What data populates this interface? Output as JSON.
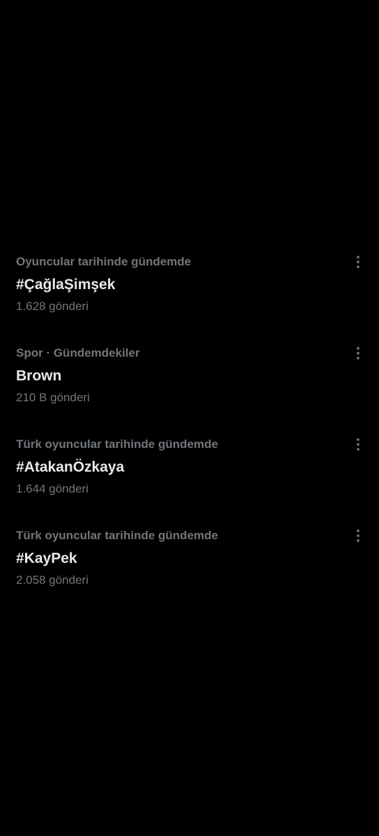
{
  "trends": [
    {
      "context": "Oyuncular tarihinde gündemde",
      "title": "#ÇağlaŞimşek",
      "count": "1.628 gönderi",
      "more_icon": "more-vertical-icon"
    },
    {
      "context": "Spor · Gündemdekiler",
      "title": "Brown",
      "count": "210 B gönderi",
      "more_icon": "more-vertical-icon"
    },
    {
      "context": "Türk oyuncular tarihinde gündemde",
      "title": "#AtakanÖzkaya",
      "count": "1.644 gönderi",
      "more_icon": "more-vertical-icon"
    },
    {
      "context": "Türk oyuncular tarihinde gündemde",
      "title": "#KayPek",
      "count": "2.058 gönderi",
      "more_icon": "more-vertical-icon"
    }
  ],
  "colors": {
    "background": "#000000",
    "primary_text": "#e7e9ea",
    "secondary_text": "#71767b"
  }
}
